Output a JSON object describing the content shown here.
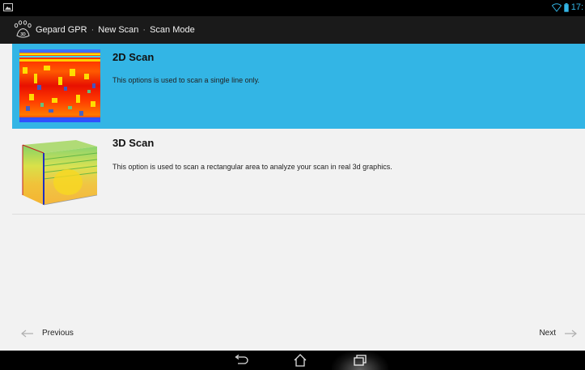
{
  "status": {
    "time": "17:",
    "wifi_icon": "wifi-icon",
    "battery_icon": "battery-icon",
    "accent": "#33b5e5"
  },
  "actionbar": {
    "logo_text": "3D",
    "crumbs": [
      "Gepard GPR",
      "New Scan",
      "Scan Mode"
    ],
    "separator": "·"
  },
  "options": [
    {
      "title": "2D Scan",
      "description": "This options is used to scan a single line only.",
      "selected": true
    },
    {
      "title": "3D Scan",
      "description": "This option is used to scan a rectangular area to analyze your scan in real 3d graphics.",
      "selected": false
    }
  ],
  "nav": {
    "previous": "Previous",
    "next": "Next"
  },
  "colors": {
    "selected_bg": "#33b5e5",
    "actionbar_bg": "#1a1a1a",
    "page_bg": "#f2f2f2"
  }
}
